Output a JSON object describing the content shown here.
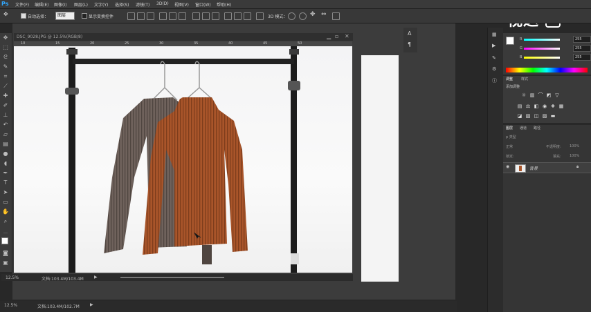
{
  "app": {
    "logo": "Ps"
  },
  "menu": [
    {
      "label": "文件(F)"
    },
    {
      "label": "编辑(E)"
    },
    {
      "label": "图像(I)"
    },
    {
      "label": "图层(L)"
    },
    {
      "label": "文字(Y)"
    },
    {
      "label": "选择(S)"
    },
    {
      "label": "滤镜(T)"
    },
    {
      "label": "3D(D)"
    },
    {
      "label": "视图(V)"
    },
    {
      "label": "窗口(W)"
    },
    {
      "label": "帮助(H)"
    }
  ],
  "watermark": "视达",
  "options": {
    "auto_select_label": "自动选择：",
    "auto_select_value": "图层",
    "show_transform_label": "显示变换控件",
    "mode_3d_label": "3D 模式："
  },
  "document": {
    "tab_title": "DSC_9028.JPG @ 12.5%(RGB/8)",
    "zoom": "12.5%",
    "doc_size": "文档:103.4M/103.4M",
    "ruler_marks": [
      "10",
      "15",
      "20",
      "25",
      "30",
      "35",
      "40",
      "45",
      "50"
    ]
  },
  "status": {
    "zoom": "12.5%",
    "doc_size": "文档:103.4M/102.7M"
  },
  "color_panel": {
    "channels": [
      {
        "label": "R",
        "value": "255"
      },
      {
        "label": "G",
        "value": "255"
      },
      {
        "label": "B",
        "value": "255"
      }
    ]
  },
  "adjust_panel": {
    "tabs": [
      "调整",
      "样式"
    ],
    "title": "添加调整"
  },
  "layers_panel": {
    "tabs": [
      "图层",
      "通道",
      "路径"
    ],
    "kind_filter": "p 类型",
    "blend_mode": "正常",
    "opacity_label": "不透明度:",
    "opacity_value": "100%",
    "lock_label": "锁定:",
    "fill_label": "填充:",
    "fill_value": "100%",
    "layer_name": "背景"
  },
  "colors": {
    "sweater_brown": "#a9552a",
    "sweater_grey": "#6f625c",
    "rack": "#1c1c1c",
    "accent_blue": "#31a8ff"
  }
}
